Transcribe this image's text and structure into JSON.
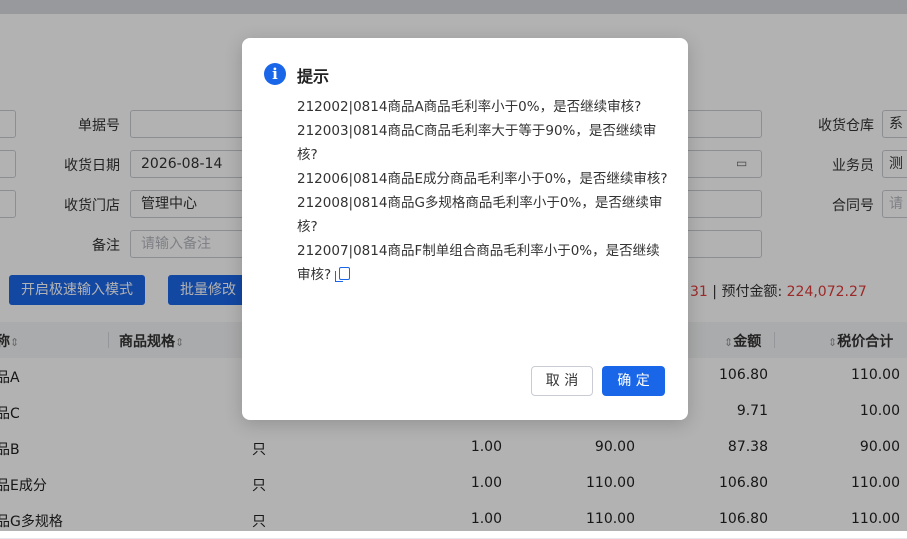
{
  "form": {
    "doc_no_label": "单据号",
    "receive_date_label": "收货日期",
    "receive_date_value": "2026-08-14",
    "receive_store_label": "收货门店",
    "receive_store_value": "管理中心",
    "remark_label": "备注",
    "remark_placeholder": "请输入备注",
    "warehouse_label": "收货仓库",
    "warehouse_value": "系",
    "salesman_label": "业务员",
    "salesman_value": "测",
    "contract_label": "合同号",
    "contract_placeholder": "请"
  },
  "toolbar": {
    "fast_input_label": "开启极速输入模式",
    "batch_edit_label": "批量修改"
  },
  "summary": {
    "partial_value": "31",
    "prepaid_label": "预付金额:",
    "prepaid_value": "224,072.27"
  },
  "table": {
    "headers": {
      "name": "称",
      "spec": "商品规格",
      "amount": "金额",
      "tax_total": "税价合计"
    },
    "rows": [
      {
        "name": "品A",
        "unit": "",
        "qty": "",
        "price": "",
        "amount": "106.80",
        "total": "110.00"
      },
      {
        "name": "品C",
        "unit": "",
        "qty": "",
        "price": "",
        "amount": "9.71",
        "total": "10.00"
      },
      {
        "name": "品B",
        "unit": "只",
        "qty": "1.00",
        "price": "90.00",
        "amount": "87.38",
        "total": "90.00"
      },
      {
        "name": "品E成分",
        "unit": "只",
        "qty": "1.00",
        "price": "110.00",
        "amount": "106.80",
        "total": "110.00"
      },
      {
        "name": "品G多规格",
        "unit": "只",
        "qty": "1.00",
        "price": "110.00",
        "amount": "106.80",
        "total": "110.00"
      }
    ]
  },
  "dialog": {
    "title": "提示",
    "messages": [
      "212002|0814商品A商品毛利率小于0%，是否继续审核?",
      "212003|0814商品C商品毛利率大于等于90%，是否继续审核?",
      "212006|0814商品E成分商品毛利率小于0%，是否继续审核?",
      "212008|0814商品G多规格商品毛利率小于0%，是否继续审核?",
      "212007|0814商品F制单组合商品毛利率小于0%，是否继续审核?"
    ],
    "cancel_label": "取 消",
    "ok_label": "确 定"
  },
  "colors": {
    "primary": "#1a66e8",
    "danger": "#e03b3b",
    "overlay": "rgba(0,0,0,0.30)"
  }
}
